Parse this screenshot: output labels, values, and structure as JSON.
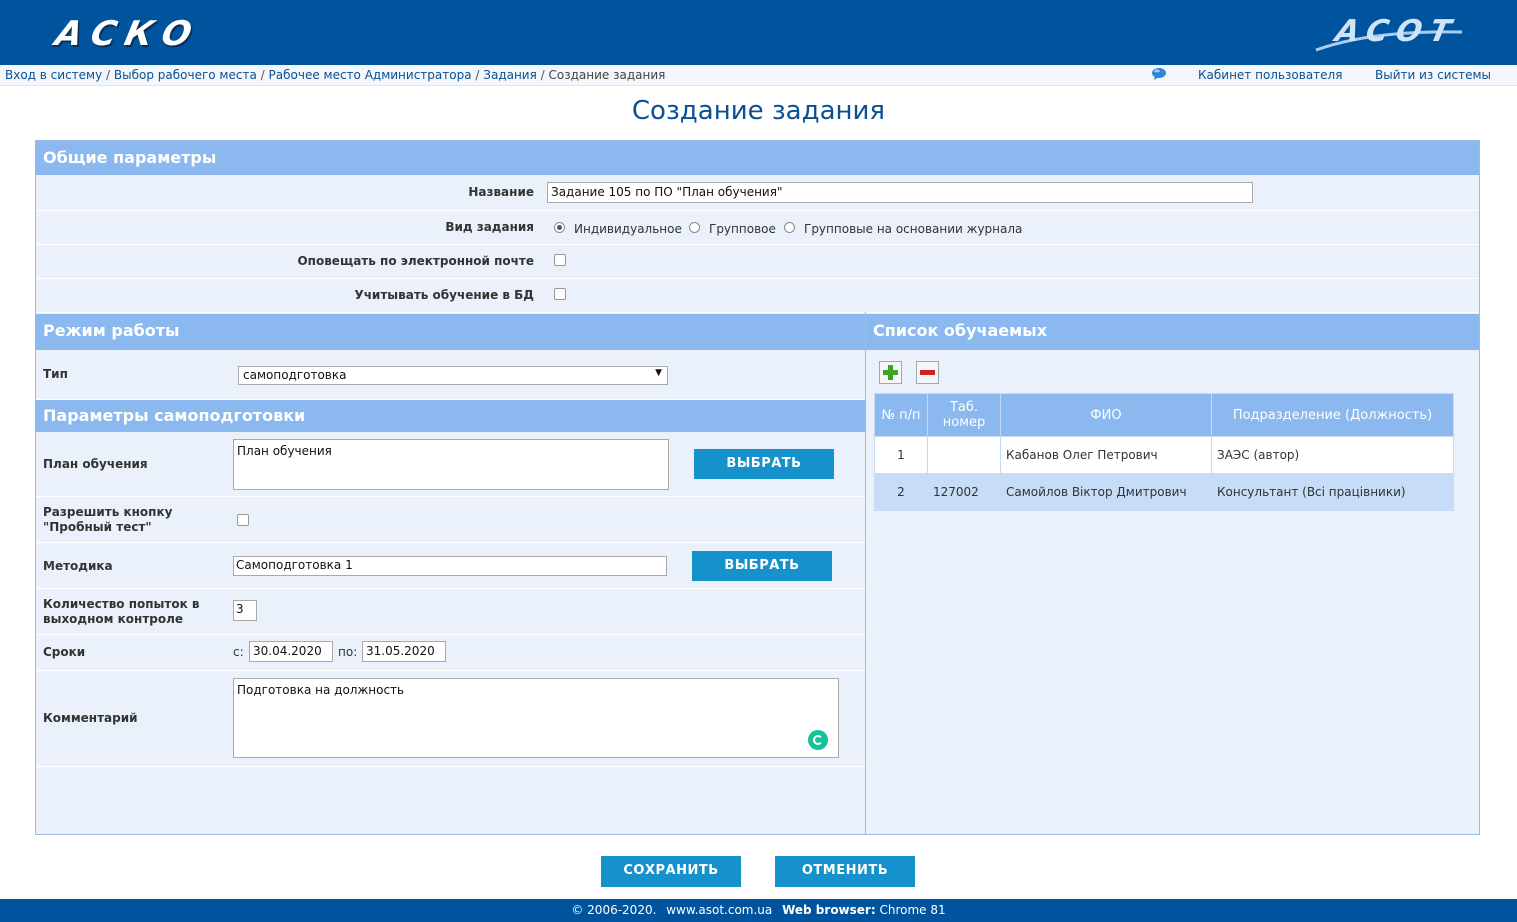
{
  "header": {
    "logo_left": "АСКО",
    "logo_right": "ACOT"
  },
  "breadcrumb": {
    "items": [
      "Вход в систему",
      "Выбор рабочего места",
      "Рабочее место Администратора",
      "Задания"
    ],
    "current": "Создание задания",
    "separator": "/",
    "cabinet": "Кабинет пользователя",
    "logout": "Выйти из системы"
  },
  "page": {
    "title": "Создание задания"
  },
  "general": {
    "header": "Общие параметры",
    "name_label": "Название",
    "name_value": "Задание 105 по ПО \"План обучения\"",
    "type_label": "Вид задания",
    "type_options": [
      "Индивидуальное",
      "Групповое",
      "Групповые на основании журнала"
    ],
    "type_selected": "Индивидуальное",
    "notify_label": "Оповещать по электронной почте",
    "notify_checked": false,
    "count_label": "Учитывать обучение в БД",
    "count_checked": false
  },
  "mode": {
    "header": "Режим работы",
    "type_label": "Тип",
    "type_value": "самоподготовка"
  },
  "self": {
    "header": "Параметры самоподготовки",
    "plan_label": "План обучения",
    "plan_value": "План обучения",
    "select_label": "ВЫБРАТЬ",
    "trial_label": "Разрешить кнопку \"Пробный тест\"",
    "trial_checked": false,
    "method_label": "Методика",
    "method_value": "Самоподготовка 1",
    "attempts_label": "Количество попыток в выходном контроле",
    "attempts_value": "3",
    "dates_label": "Сроки",
    "from_label": "с:",
    "from_value": "30.04.2020",
    "to_label": "по:",
    "to_value": "31.05.2020",
    "comment_label": "Комментарий",
    "comment_value": "Подготовка на должность"
  },
  "trainees": {
    "header": "Список обучаемых",
    "columns": [
      "№ п/п",
      "Таб. номер",
      "ФИО",
      "Подразделение (Должность)"
    ],
    "rows": [
      [
        "1",
        "",
        "Кабанов Олег Петрович",
        "ЗАЭС (автор)"
      ],
      [
        "2",
        "127002",
        "Самойлов Віктор Дмитрович",
        "Консультант (Всі працівники)"
      ]
    ]
  },
  "actions": {
    "save": "СОХРАНИТЬ",
    "cancel": "ОТМЕНИТЬ"
  },
  "footer": {
    "copyright": "© 2006-2020.",
    "site": "www.asot.com.ua",
    "browser_label": "Web browser:",
    "browser": "Chrome 81"
  },
  "colors": {
    "brand": "#00549e",
    "section": "#8bb8ee",
    "button": "#1591cc",
    "link": "#0b4f94"
  }
}
